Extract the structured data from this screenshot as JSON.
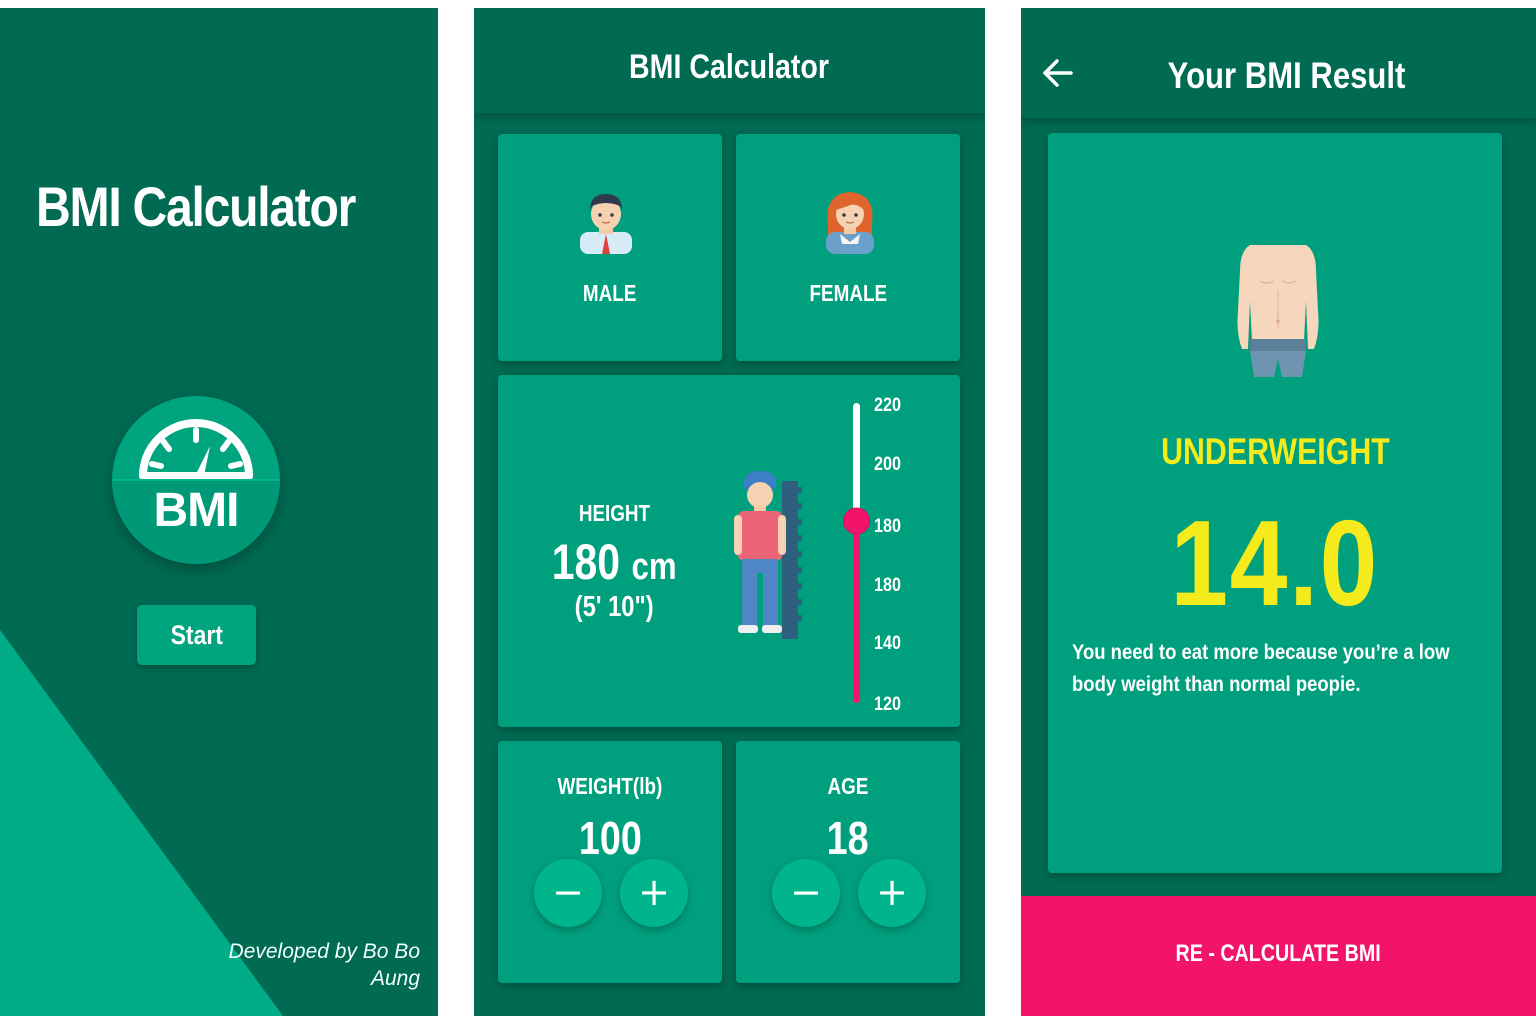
{
  "splash": {
    "title": "BMI Calculator",
    "logo_text": "BMI",
    "logo_icon": "speedometer-icon",
    "start_label": "Start",
    "developer_line1": "Developed by Bo Bo",
    "developer_line2": "Aung"
  },
  "calculator": {
    "title": "BMI Calculator",
    "gender_male": "MALE",
    "gender_female": "FEMALE",
    "height_label": "HEIGHT",
    "height_value": "180",
    "height_unit": "cm",
    "height_feet": "(5' 10\")",
    "height_slider_value": 180,
    "height_scale": [
      "220",
      "200",
      "180",
      "180",
      "140",
      "120"
    ],
    "weight_label": "WEIGHT(lb)",
    "weight_value": "100",
    "age_label": "AGE",
    "age_value": "18",
    "minus_glyph": "−",
    "plus_glyph": "+"
  },
  "result": {
    "title": "Your BMI Result",
    "back_icon": "arrow-back-icon",
    "status": "UNDERWEIGHT",
    "value": "14.0",
    "message": "You need to eat more because you’re a low body weight than normal peopie.",
    "recalculate_label": "RE - CALCULATE BMI"
  },
  "colors": {
    "background": "#006a52",
    "card": "#009f7d",
    "accent_light": "#00a47f",
    "pink": "#f2146b",
    "yellow": "#f5ea1c"
  }
}
